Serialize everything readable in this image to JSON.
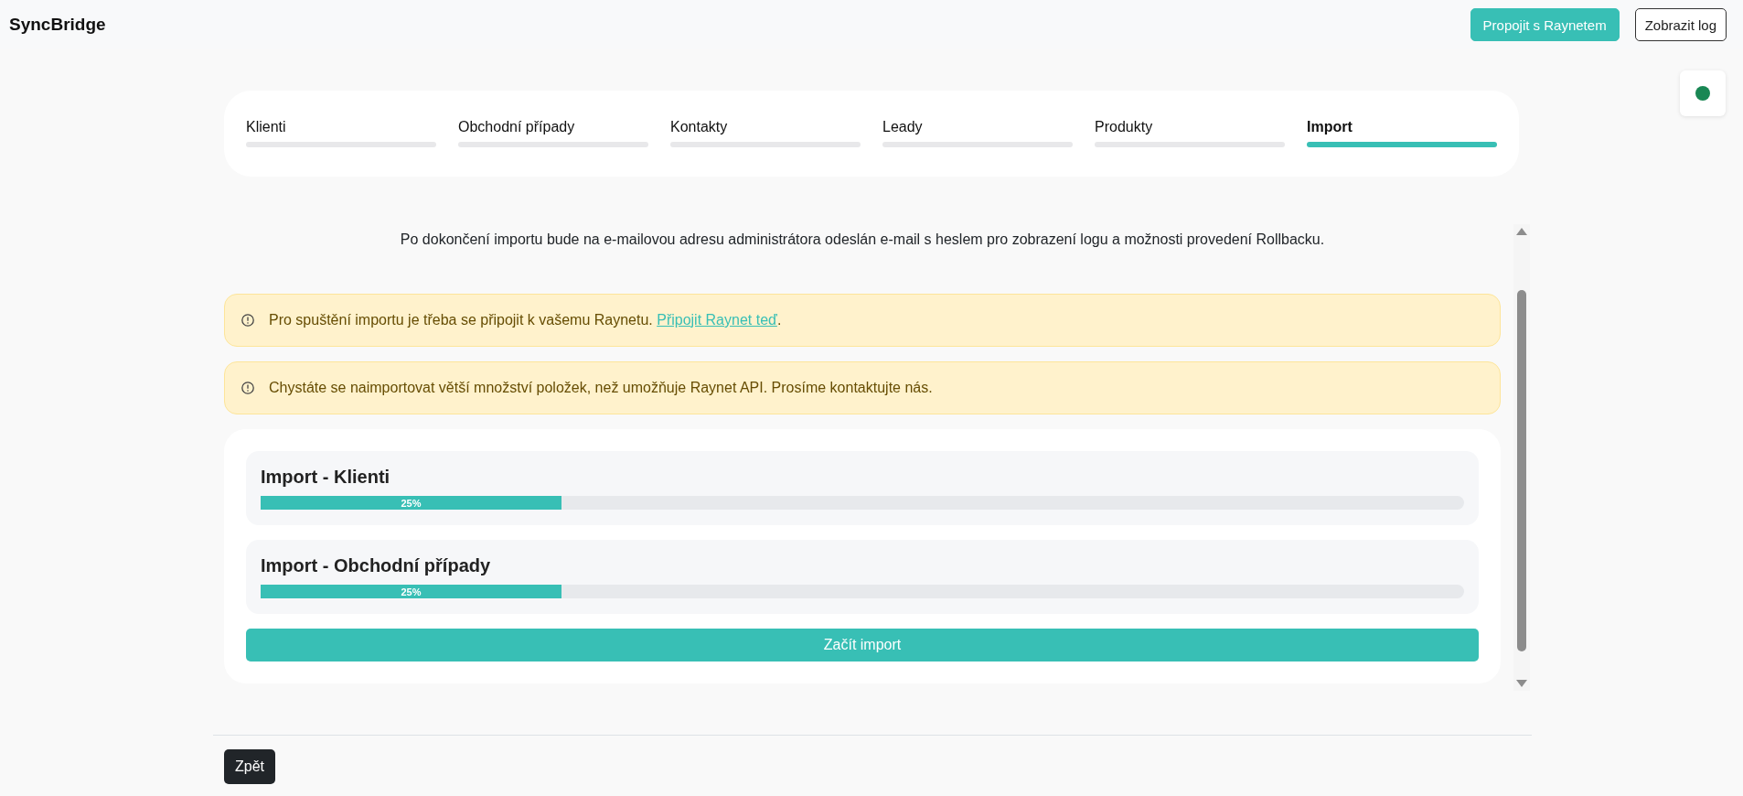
{
  "header": {
    "title": "SyncBridge",
    "buttons": [
      {
        "label": "Propojit s Raynetem",
        "kind": "primary"
      },
      {
        "label": "Zobrazit log",
        "kind": "outline"
      }
    ]
  },
  "status_indicator": {
    "connected": true
  },
  "tabs": [
    {
      "label": "Klienti",
      "selected": false
    },
    {
      "label": "Obchodní případy",
      "selected": false
    },
    {
      "label": "Kontakty",
      "selected": false
    },
    {
      "label": "Leady",
      "selected": false
    },
    {
      "label": "Produkty",
      "selected": false
    },
    {
      "label": "Import",
      "selected": true
    }
  ],
  "info_text": "Po dokončení importu bude na e-mailovou adresu administrátora odeslán e-mail s heslem pro zobrazení logu a možnosti provedení Rollbacku.",
  "alerts": [
    {
      "text": "Pro spuštění importu je třeba se připojit k vašemu Raynetu.",
      "link": "Připojit Raynet teď",
      "suffix": "."
    },
    {
      "text": "Chystáte se naimportovat větší množství položek, než umožňuje Raynet API. Prosíme kontaktujte nás."
    }
  ],
  "imports": [
    {
      "title": "Import - Klienti",
      "level": 0.25,
      "reading": "25%"
    },
    {
      "title": "Import - Obchodní případy",
      "level": 0.25,
      "reading": "25%"
    }
  ],
  "start_button": "Začít import",
  "back_button": "Zpět"
}
